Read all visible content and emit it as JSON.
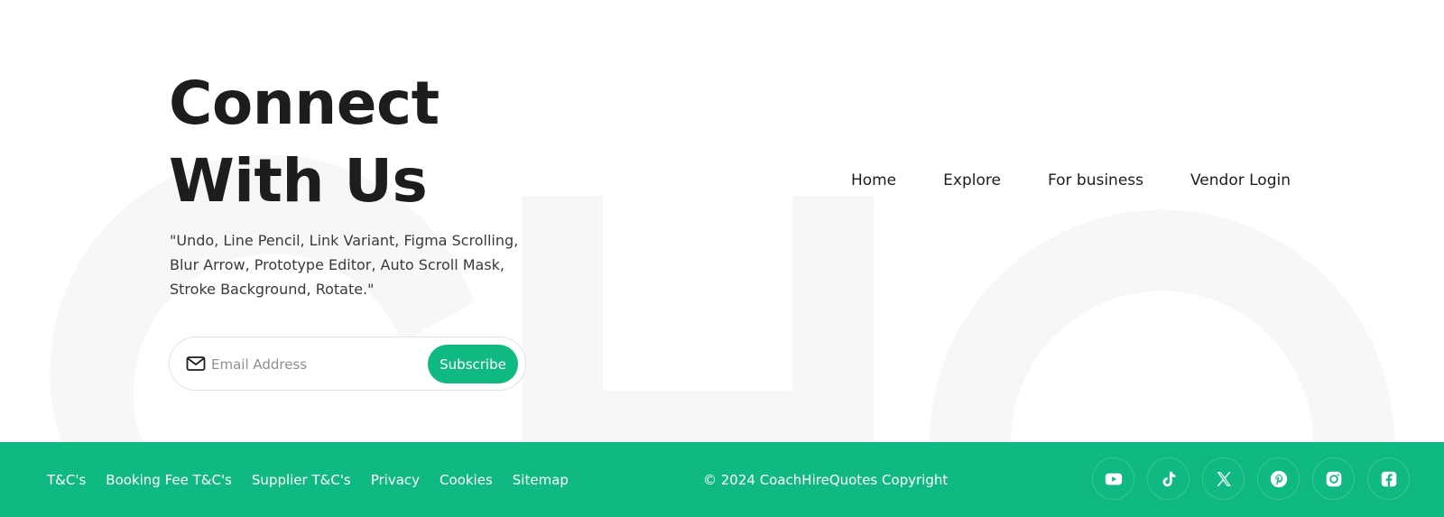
{
  "hero": {
    "title_line1": "Connect",
    "title_line2": "With Us",
    "description": "\"Undo, Line Pencil, Link Variant, Figma Scrolling, Blur Arrow, Prototype Editor, Auto Scroll Mask, Stroke Background, Rotate.\""
  },
  "subscribe": {
    "email_placeholder": "Email Address",
    "email_value": "",
    "button_label": "Subscribe",
    "icon": "mail-icon"
  },
  "nav": {
    "items": [
      {
        "label": "Home"
      },
      {
        "label": "Explore"
      },
      {
        "label": "For business"
      },
      {
        "label": "Vendor Login"
      }
    ]
  },
  "footer": {
    "links": [
      {
        "label": "T&C's"
      },
      {
        "label": "Booking Fee T&C's"
      },
      {
        "label": "Supplier T&C's"
      },
      {
        "label": "Privacy"
      },
      {
        "label": "Cookies"
      },
      {
        "label": "Sitemap"
      }
    ],
    "copyright": "© 2024 CoachHireQuotes Copyright",
    "socials": [
      {
        "icon": "youtube-icon"
      },
      {
        "icon": "tiktok-icon"
      },
      {
        "icon": "x-icon"
      },
      {
        "icon": "pinterest-icon"
      },
      {
        "icon": "instagram-icon"
      },
      {
        "icon": "facebook-icon"
      }
    ]
  },
  "colors": {
    "accent": "#10b981",
    "text_dark": "#1d1d1d",
    "text_body": "#3a3a3a",
    "background_letters": "#f6f8f7"
  }
}
